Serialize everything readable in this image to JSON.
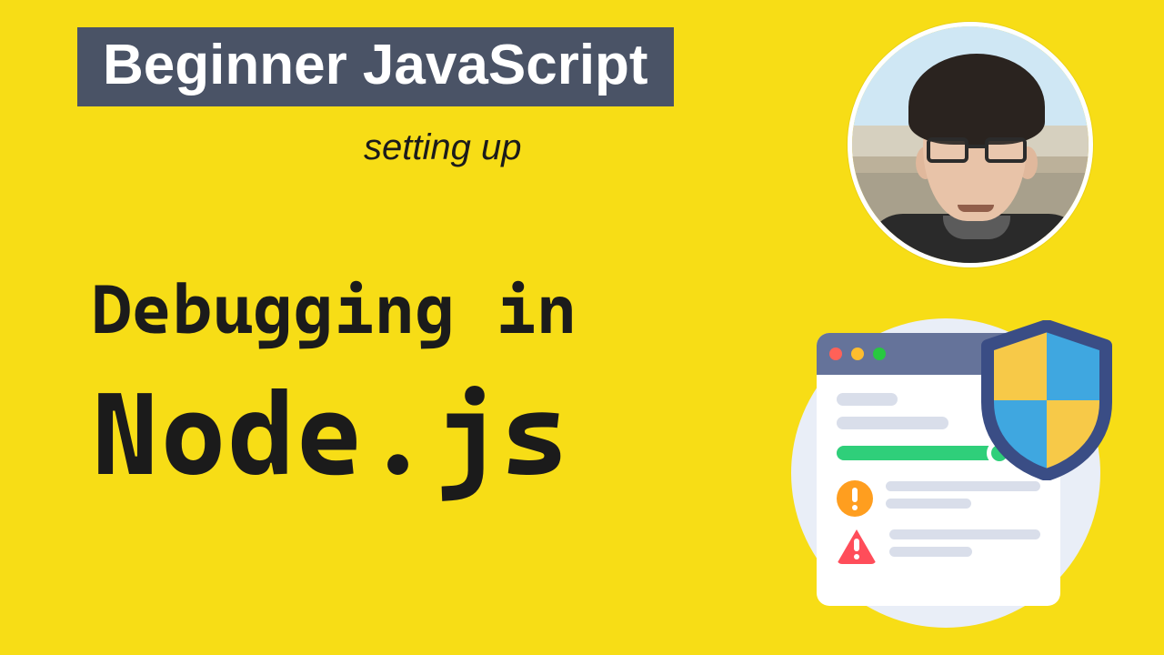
{
  "badge": {
    "label": "Beginner JavaScript"
  },
  "subtitle": "setting up",
  "title": {
    "line1": "Debugging in",
    "line2": "Node.js"
  },
  "colors": {
    "background": "#f7dd16",
    "badge_bg": "#4a5366",
    "badge_fg": "#ffffff",
    "text": "#1b1b1b",
    "illus_disc": "#e9eef7",
    "illus_titlebar": "#65739a",
    "slider_fill": "#2fcf7a",
    "warn_icon": "#ff9e1f",
    "alert_icon": "#ff4d5a",
    "shield_outline": "#3a4d85",
    "shield_blue": "#3fa7e0",
    "shield_yellow": "#f7c948"
  },
  "icons": {
    "traffic_dots": [
      "close-dot",
      "minimize-dot",
      "zoom-dot"
    ],
    "warn": "warning-icon",
    "alert": "alert-triangle-icon",
    "shield": "shield-icon"
  }
}
